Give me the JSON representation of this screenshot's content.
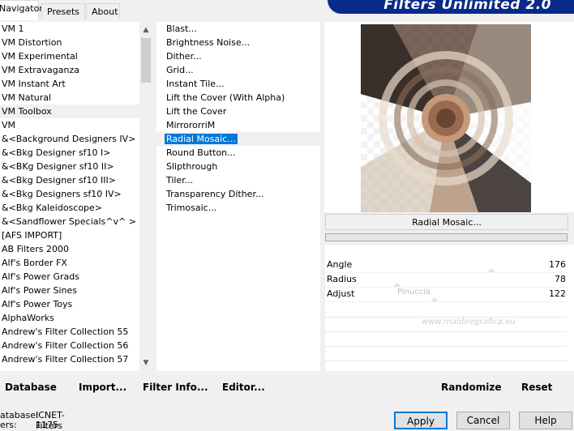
{
  "tabs": [
    "Navigator",
    "Presets",
    "About"
  ],
  "banner": "Filters Unlimited 2.0",
  "categories": [
    "VM 1",
    "VM Distortion",
    "VM Experimental",
    "VM Extravaganza",
    "VM Instant Art",
    "VM Natural",
    "VM Toolbox",
    "VM",
    "&<Background Designers IV>",
    "&<Bkg Designer sf10 I>",
    "&<BKg Designer sf10 II>",
    "&<Bkg Designer sf10 III>",
    "&<Bkg Designers sf10 IV>",
    "&<Bkg Kaleidoscope>",
    "&<Sandflower Specials^v^ >",
    "[AFS IMPORT]",
    "AB Filters 2000",
    "Alf's Border FX",
    "Alf's Power Grads",
    "Alf's Power Sines",
    "Alf's Power Toys",
    "AlphaWorks",
    "Andrew's Filter Collection 55",
    "Andrew's Filter Collection 56",
    "Andrew's Filter Collection 57"
  ],
  "selected_category": "VM Toolbox",
  "filters": [
    "Blast...",
    "Brightness Noise...",
    "Dither...",
    "Grid...",
    "Instant Tile...",
    "Lift the Cover (With Alpha)",
    "Lift the Cover",
    "MirrororriM",
    "Radial Mosaic...",
    "Round Button...",
    "Slipthrough",
    "Tiler...",
    "Transparency Dither...",
    "Trimosaic..."
  ],
  "selected_filter": "Radial Mosaic...",
  "filter_name": "Radial Mosaic...",
  "params": [
    {
      "label": "Angle",
      "value": "176"
    },
    {
      "label": "Radius",
      "value": "78"
    },
    {
      "label": "Adjust",
      "value": "122"
    }
  ],
  "watermark": {
    "line1": "Pinuccia",
    "line2": "www.maldiregrafica.eu"
  },
  "left_buttons": {
    "database": "Database",
    "import": "Import...",
    "filter_info": "Filter Info...",
    "editor": "Editor..."
  },
  "right_buttons": {
    "randomize": "Randomize",
    "reset": "Reset"
  },
  "status": {
    "database_label": "atabase:",
    "database_value": "ICNET-Filters",
    "filters_label": "ers:",
    "filters_value": "1175"
  },
  "dialog_buttons": {
    "apply": "Apply",
    "cancel": "Cancel",
    "help": "Help"
  },
  "colors": {
    "selection": "#0078d7",
    "banner": "#0a2a8a"
  }
}
